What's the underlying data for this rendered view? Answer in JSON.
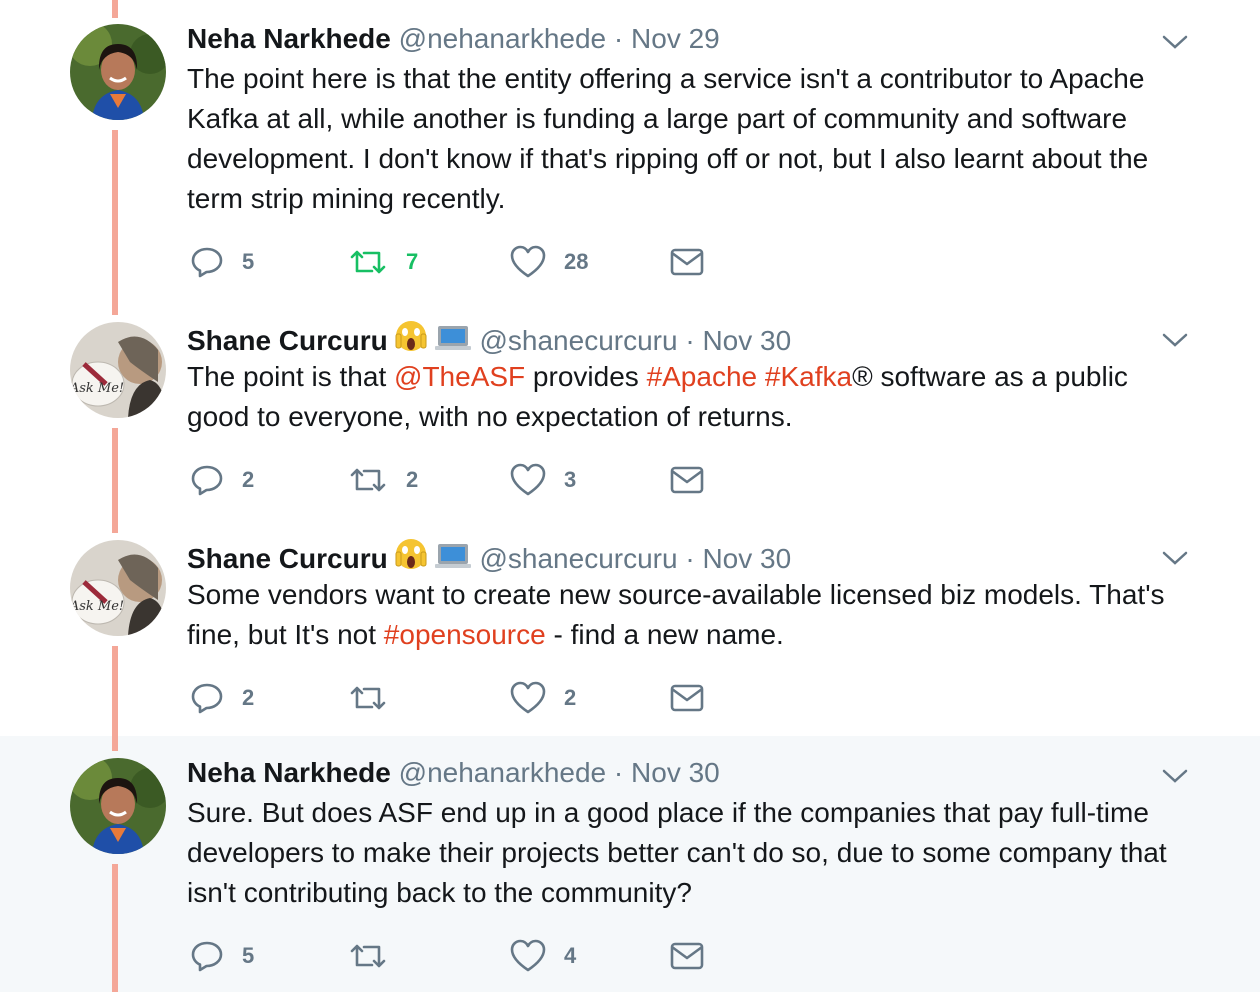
{
  "colors": {
    "thread_line": "#f4a798",
    "link": "#e0401f",
    "secondary": "#657786",
    "retweet_active": "#17bf63",
    "highlight_bg": "#f5f8fa"
  },
  "tweets": [
    {
      "name": "Neha Narkhede",
      "handle": "@nehanarkhede",
      "separator": "·",
      "date": "Nov 29",
      "emoji": [],
      "text": [
        {
          "t": "The point here is that the entity offering a service isn't a contributor to Apache Kafka at all, while another is funding a large part of community and software development. I don't know if that's ripping off or not, but I also learnt about the term strip mining recently.",
          "link": false
        }
      ],
      "replies": "5",
      "retweets": "7",
      "likes": "28",
      "retweeted": true,
      "highlighted": false
    },
    {
      "name": "Shane Curcuru",
      "handle": "@shanecurcuru",
      "separator": "·",
      "date": "Nov 30",
      "emoji": [
        "screaming-face-emoji",
        "laptop-emoji"
      ],
      "text": [
        {
          "t": "The point is that ",
          "link": false
        },
        {
          "t": "@TheASF",
          "link": true
        },
        {
          "t": " provides ",
          "link": false
        },
        {
          "t": "#Apache",
          "link": true
        },
        {
          "t": " ",
          "link": false
        },
        {
          "t": "#Kafka",
          "link": true
        },
        {
          "t": "® software as a public good to everyone, with no expectation of returns.",
          "link": false
        }
      ],
      "replies": "2",
      "retweets": "2",
      "likes": "3",
      "retweeted": false,
      "highlighted": false
    },
    {
      "name": "Shane Curcuru",
      "handle": "@shanecurcuru",
      "separator": "·",
      "date": "Nov 30",
      "emoji": [
        "screaming-face-emoji",
        "laptop-emoji"
      ],
      "text": [
        {
          "t": "Some vendors want to create new source-available licensed biz models. That's fine, but It's not ",
          "link": false
        },
        {
          "t": "#opensource",
          "link": true
        },
        {
          "t": " - find a new name.",
          "link": false
        }
      ],
      "replies": "2",
      "retweets": "",
      "likes": "2",
      "retweeted": false,
      "highlighted": false
    },
    {
      "name": "Neha Narkhede",
      "handle": "@nehanarkhede",
      "separator": "·",
      "date": "Nov 30",
      "emoji": [],
      "text": [
        {
          "t": "Sure. But does ASF end up in a good place if the companies that pay full-time developers to make their projects better can't do so, due to some company that isn't contributing back to the community?",
          "link": false
        }
      ],
      "replies": "5",
      "retweets": "",
      "likes": "4",
      "retweeted": false,
      "highlighted": true
    }
  ],
  "avatar_badge_text": "Ask Me!"
}
